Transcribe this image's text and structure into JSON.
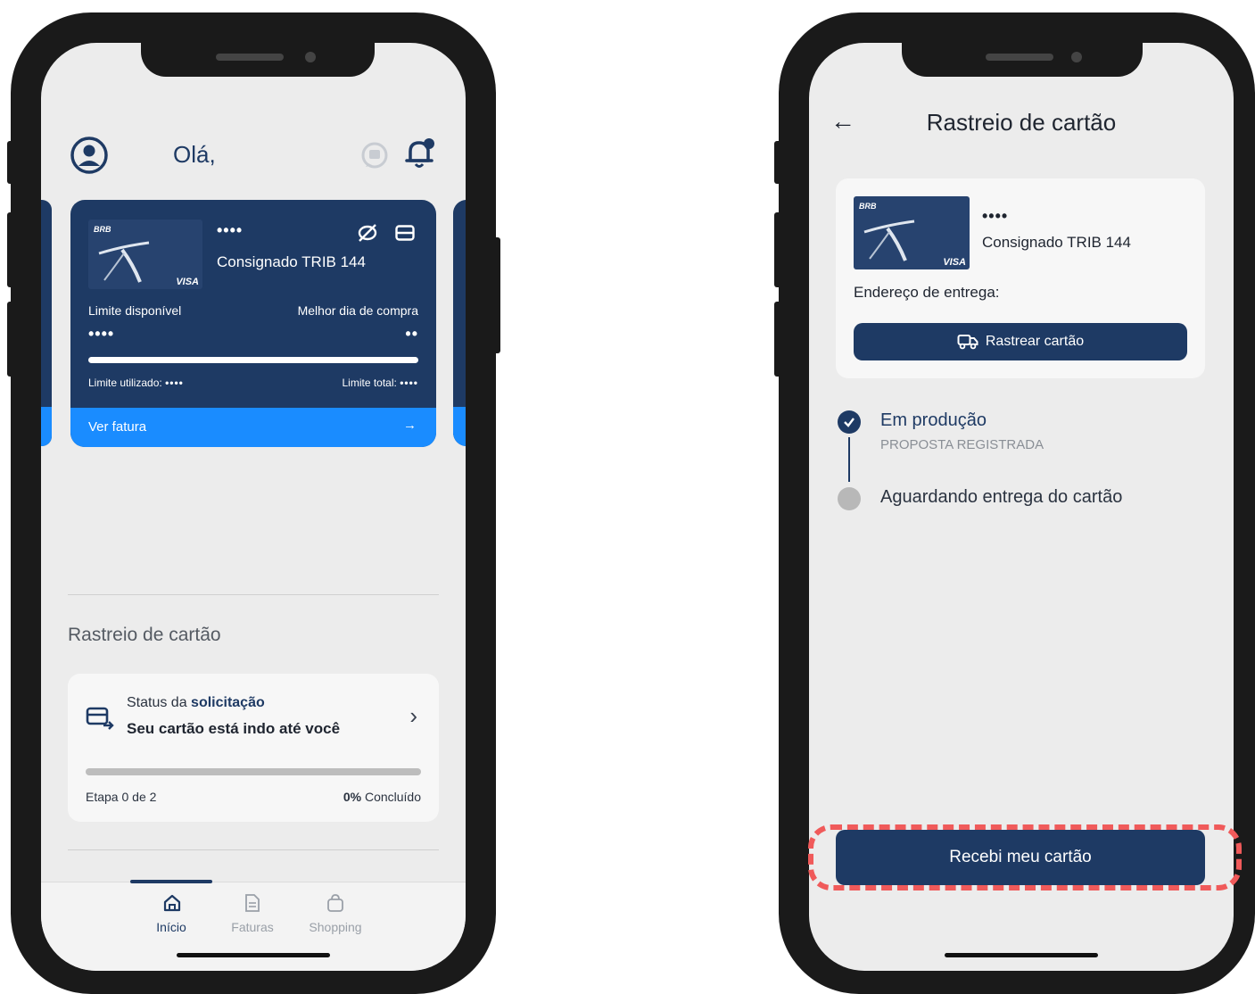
{
  "colors": {
    "navy": "#1e3a64",
    "accent_blue": "#1a8cff",
    "highlight": "#f05a5a",
    "screen_bg": "#ececec"
  },
  "left": {
    "header": {
      "greeting": "Olá,",
      "profile_icon": "user-circle-icon",
      "chat_icon": "chat-icon",
      "bell_icon": "bell-icon"
    },
    "card": {
      "brand": "BRB",
      "network": "VISA",
      "masked_number": "••••",
      "name": "Consignado TRIB 144",
      "limit_label": "Limite disponível",
      "limit_value": "••••",
      "best_day_label": "Melhor dia de compra",
      "best_day_value": "••",
      "used_label": "Limite utilizado:",
      "used_value": "••••",
      "total_label": "Limite total:",
      "total_value": "••••",
      "footer_link": "Ver fatura",
      "footer_arrow": "→",
      "limit_used_fraction": 0
    },
    "tracking": {
      "section_title": "Rastreio de cartão",
      "status_prefix": "Status da ",
      "status_highlight": "solicitação",
      "status_message": "Seu cartão está indo até você",
      "chevron": "›",
      "step_text": "Etapa 0 de 2",
      "percent": "0%",
      "percent_suffix": " Concluído",
      "progress_fraction": 0
    },
    "nav": [
      {
        "label": "Início",
        "icon": "home-icon",
        "active": true
      },
      {
        "label": "Faturas",
        "icon": "document-icon",
        "active": false
      },
      {
        "label": "Shopping",
        "icon": "shopping-bag-icon",
        "active": false
      }
    ]
  },
  "right": {
    "header": {
      "back": "←",
      "title": "Rastreio de cartão"
    },
    "card": {
      "brand": "BRB",
      "network": "VISA",
      "masked_number": "••••",
      "name": "Consignado TRIB 144",
      "address_label": "Endereço de entrega:",
      "track_button": "Rastrear cartão"
    },
    "timeline": [
      {
        "title": "Em produção",
        "subtitle": "PROPOSTA REGISTRADA",
        "done": true
      },
      {
        "title": "Aguardando entrega do cartão",
        "subtitle": "",
        "done": false
      }
    ],
    "confirm_button": "Recebi meu cartão"
  }
}
